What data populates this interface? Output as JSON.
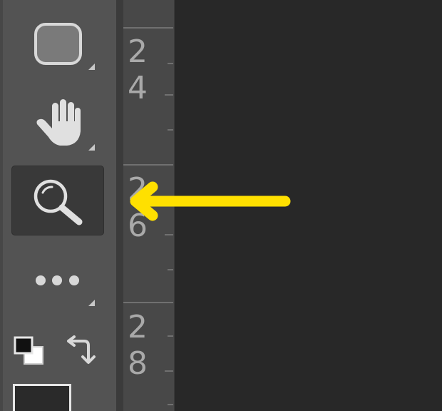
{
  "toolbar": {
    "tools": [
      {
        "id": "rectangle-tool",
        "icon": "rounded-rectangle-icon",
        "has_flyout": true,
        "active": false
      },
      {
        "id": "hand-tool",
        "icon": "hand-icon",
        "has_flyout": true,
        "active": false
      },
      {
        "id": "zoom-tool",
        "icon": "magnifier-icon",
        "has_flyout": false,
        "active": true
      },
      {
        "id": "more-tools",
        "icon": "ellipsis-icon",
        "has_flyout": true,
        "active": false
      }
    ],
    "color_controls": {
      "default_colors_icon": "default-colors-icon",
      "swap_colors_icon": "swap-colors-icon",
      "foreground_color": "#2a2a2a"
    }
  },
  "ruler": {
    "labels": [
      {
        "value": "24",
        "digits": [
          "2",
          "4"
        ]
      },
      {
        "value": "26",
        "digits": [
          "2",
          "6"
        ]
      },
      {
        "value": "28",
        "digits": [
          "2",
          "8"
        ]
      }
    ]
  },
  "annotation": {
    "arrow_color": "#ffe000",
    "points_to": "zoom-tool"
  },
  "colors": {
    "toolbar_bg": "#535353",
    "ruler_bg": "#484848",
    "canvas_bg": "#282828",
    "active_tool_bg": "#393939",
    "icon": "#d8d8d8",
    "ruler_text": "#a9a9a9"
  }
}
